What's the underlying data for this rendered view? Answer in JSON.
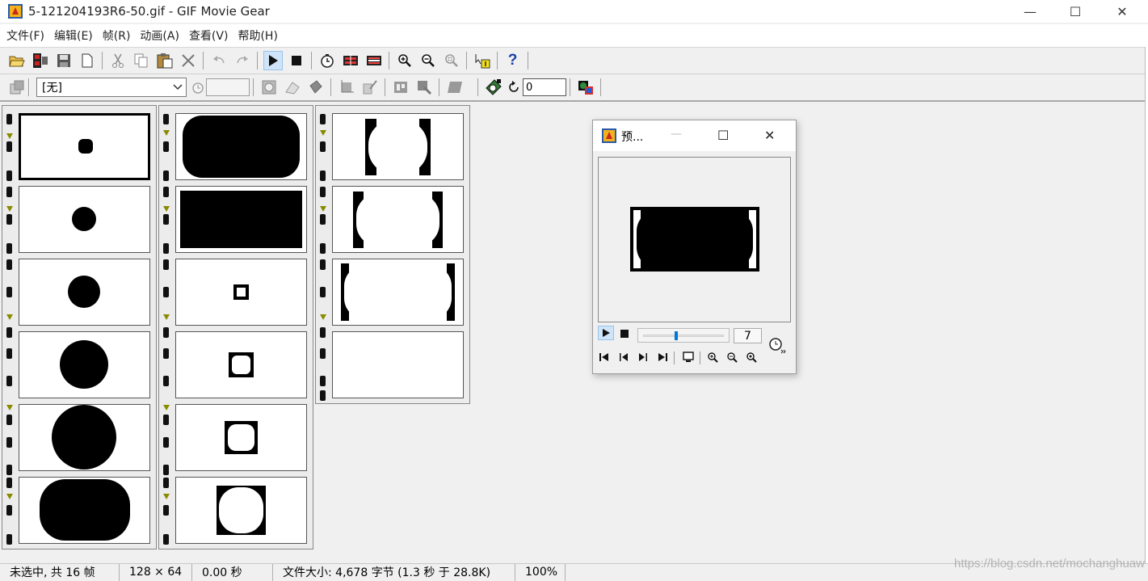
{
  "window": {
    "title": "5-121204193R6-50.gif - GIF Movie Gear",
    "minimize_glyph": "—",
    "maximize_glyph": "☐",
    "close_glyph": "✕"
  },
  "menu": [
    {
      "label": "文件(F)"
    },
    {
      "label": "编辑(E)"
    },
    {
      "label": "帧(R)"
    },
    {
      "label": "动画(A)"
    },
    {
      "label": "查看(V)"
    },
    {
      "label": "帮助(H)"
    }
  ],
  "toolbar1": {
    "icons": [
      "open-icon",
      "insert-frames-icon",
      "save-icon",
      "new-icon",
      "cut-icon",
      "copy-icon",
      "paste-icon",
      "delete-icon",
      "undo-icon",
      "redo-icon",
      "play-icon",
      "stop-icon",
      "timing-icon",
      "optimize-icon",
      "reduce-icon",
      "zoom-in-icon",
      "zoom-out-icon",
      "zoom-fit-icon",
      "frame-info-icon",
      "help-icon"
    ],
    "help_glyph": "?"
  },
  "toolbar2": {
    "disposal_method": "[无]",
    "loop_count": "0"
  },
  "frames": {
    "count": 16
  },
  "preview": {
    "title": "预...",
    "current_frame": "7",
    "slider_value": 0.41,
    "close_glyph": "✕",
    "maximize_glyph": "☐",
    "minimize_glyph": "—"
  },
  "status": {
    "selection": "未选中, 共 16 帧",
    "dimensions": "128 × 64",
    "duration": "0.00 秒",
    "file_size": "文件大小: 4,678 字节 (1.3 秒 于 28.8K)",
    "zoom": "100%"
  },
  "watermark": "https://blog.csdn.net/mochanghuaw",
  "colors": {
    "chrome": "#f0f0f0",
    "pressed": "#cfe4f8",
    "accent": "#0078d7"
  }
}
